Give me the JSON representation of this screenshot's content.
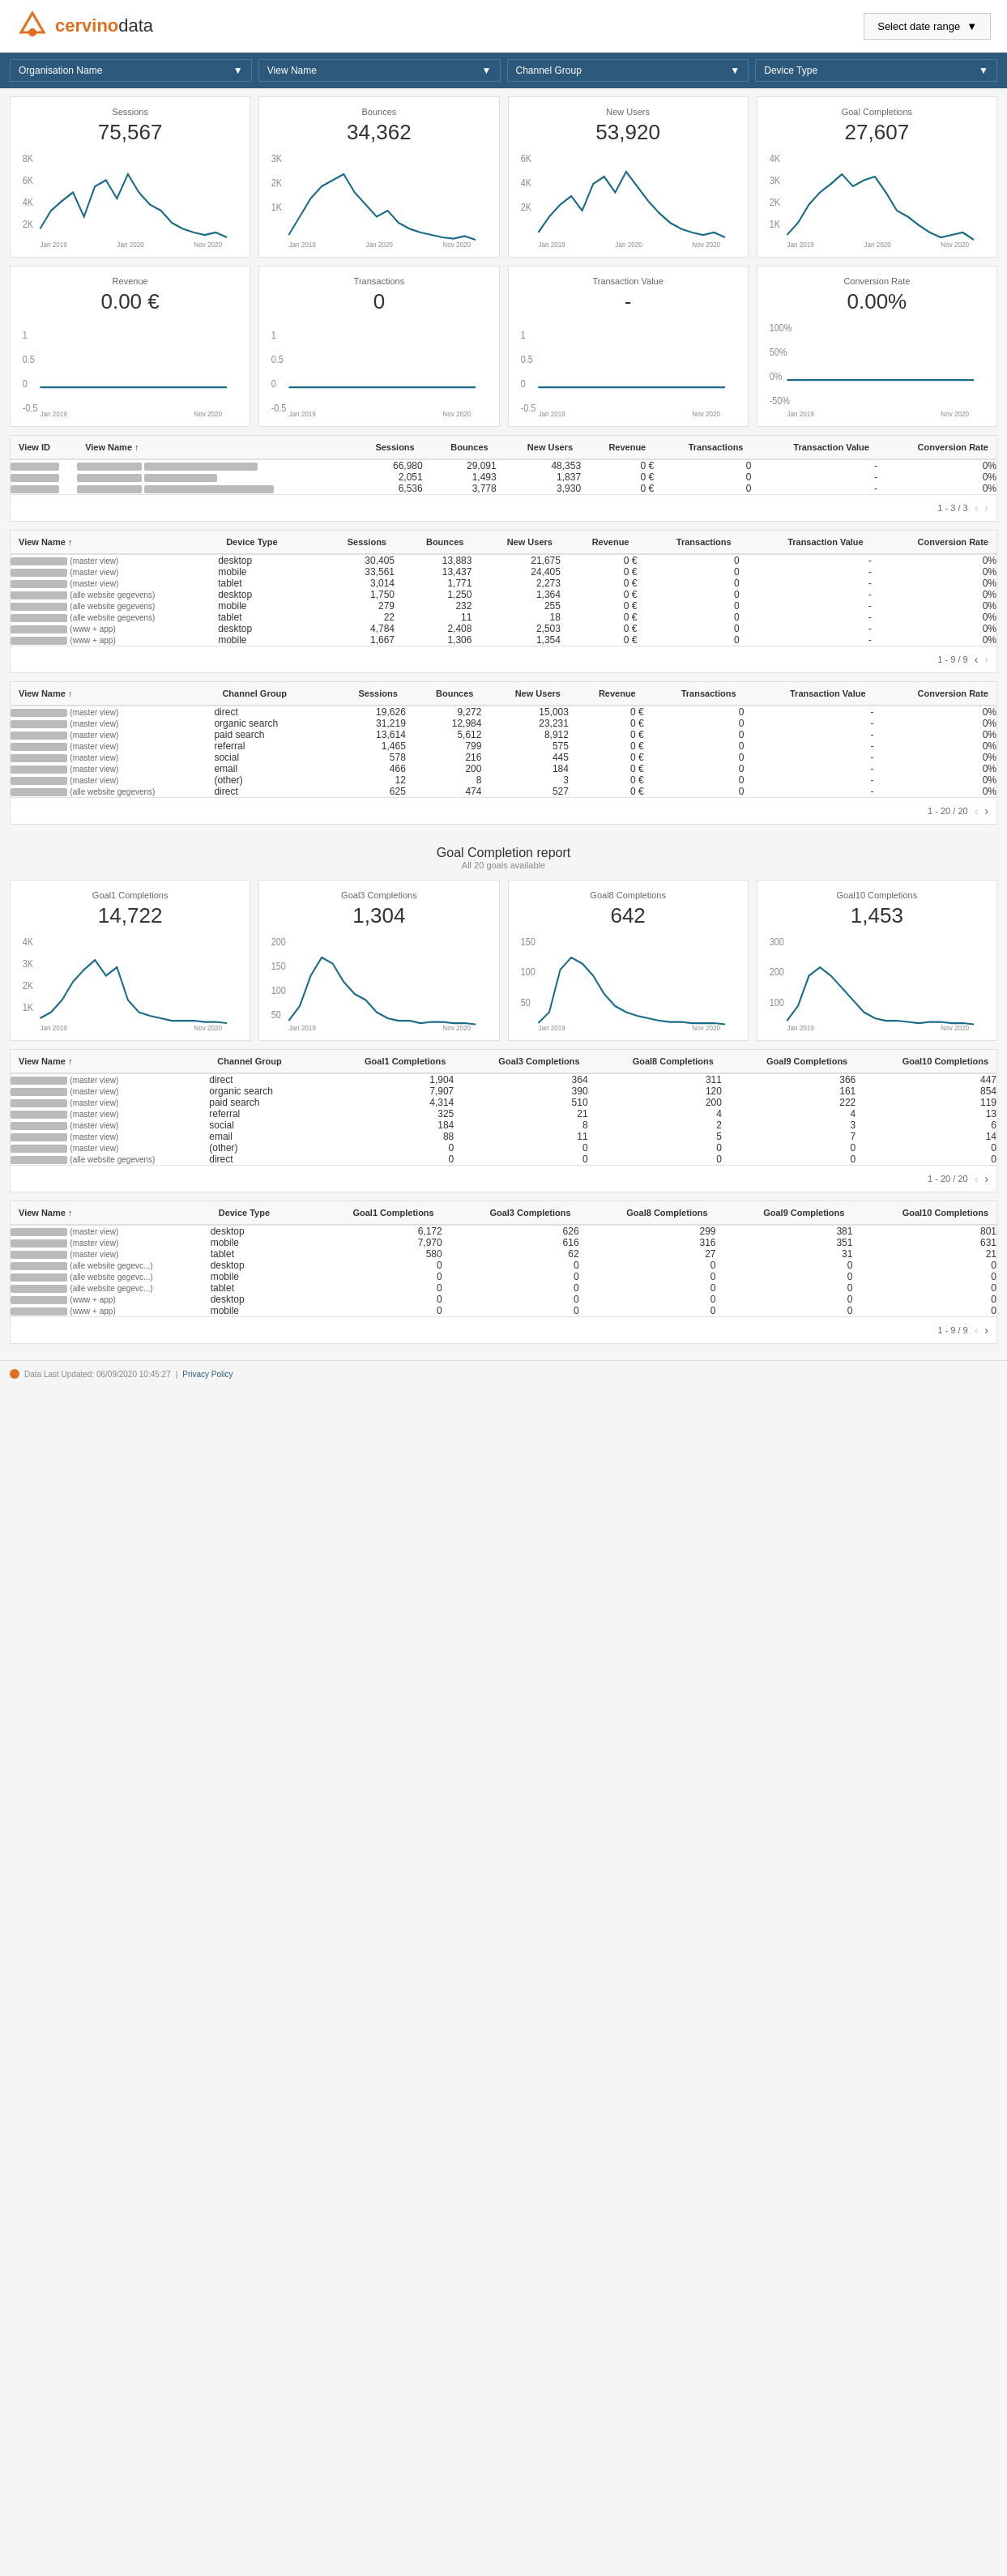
{
  "header": {
    "logo_text": "cervinodata",
    "logo_accent": "cervino",
    "date_range_label": "Select date range"
  },
  "filters": [
    {
      "id": "org",
      "label": "Organisation Name"
    },
    {
      "id": "view",
      "label": "View Name"
    },
    {
      "id": "channel",
      "label": "Channel Group"
    },
    {
      "id": "device",
      "label": "Device Type"
    }
  ],
  "kpi_row1": [
    {
      "id": "sessions",
      "label": "Sessions",
      "value": "75,567"
    },
    {
      "id": "bounces",
      "label": "Bounces",
      "value": "34,362"
    },
    {
      "id": "new_users",
      "label": "New Users",
      "value": "53,920"
    },
    {
      "id": "goal_completions",
      "label": "Goal Completions",
      "value": "27,607"
    }
  ],
  "kpi_row2": [
    {
      "id": "revenue",
      "label": "Revenue",
      "value": "0.00 €"
    },
    {
      "id": "transactions",
      "label": "Transactions",
      "value": "0"
    },
    {
      "id": "transaction_value",
      "label": "Transaction Value",
      "value": "-"
    },
    {
      "id": "conversion_rate",
      "label": "Conversion Rate",
      "value": "0.00%"
    }
  ],
  "table1": {
    "columns": [
      "View ID",
      "View Name ↑",
      "Sessions",
      "Bounces",
      "New Users",
      "Revenue",
      "Transactions",
      "Transaction Value",
      "Conversion Rate"
    ],
    "rows": [
      {
        "view_id": "redacted",
        "view_name": "redacted_lg",
        "sessions": "66,980",
        "bounces": "29,091",
        "new_users": "48,353",
        "revenue": "0 €",
        "transactions": "0",
        "transaction_value": "-",
        "conversion_rate": "0%"
      },
      {
        "view_id": "redacted",
        "view_name": "redacted_md",
        "sessions": "2,051",
        "bounces": "1,493",
        "new_users": "1,837",
        "revenue": "0 €",
        "transactions": "0",
        "transaction_value": "-",
        "conversion_rate": "0%"
      },
      {
        "view_id": "redacted",
        "view_name": "redacted_xl",
        "sessions": "6,536",
        "bounces": "3,778",
        "new_users": "3,930",
        "revenue": "0 €",
        "transactions": "0",
        "transaction_value": "-",
        "conversion_rate": "0%"
      }
    ],
    "pagination": "1 - 3 / 3"
  },
  "table2": {
    "columns": [
      "View Name ↑",
      "Device Type",
      "Sessions",
      "Bounces",
      "New Users",
      "Revenue",
      "Transactions",
      "Transaction Value",
      "Conversion Rate"
    ],
    "rows": [
      {
        "view_name": "redacted",
        "view_sub": "(master view)",
        "device": "desktop",
        "sessions": "30,405",
        "bounces": "13,883",
        "new_users": "21,675",
        "revenue": "0 €",
        "transactions": "0",
        "transaction_value": "-",
        "conversion_rate": "0%"
      },
      {
        "view_name": "redacted",
        "view_sub": "(master view)",
        "device": "mobile",
        "sessions": "33,561",
        "bounces": "13,437",
        "new_users": "24,405",
        "revenue": "0 €",
        "transactions": "0",
        "transaction_value": "-",
        "conversion_rate": "0%"
      },
      {
        "view_name": "redacted",
        "view_sub": "(master view)",
        "device": "tablet",
        "sessions": "3,014",
        "bounces": "1,771",
        "new_users": "2,273",
        "revenue": "0 €",
        "transactions": "0",
        "transaction_value": "-",
        "conversion_rate": "0%"
      },
      {
        "view_name": "redacted",
        "view_sub": "(alle website gegevens)",
        "device": "desktop",
        "sessions": "1,750",
        "bounces": "1,250",
        "new_users": "1,364",
        "revenue": "0 €",
        "transactions": "0",
        "transaction_value": "-",
        "conversion_rate": "0%"
      },
      {
        "view_name": "redacted",
        "view_sub": "(alle website gegevens)",
        "device": "mobile",
        "sessions": "279",
        "bounces": "232",
        "new_users": "255",
        "revenue": "0 €",
        "transactions": "0",
        "transaction_value": "-",
        "conversion_rate": "0%"
      },
      {
        "view_name": "redacted",
        "view_sub": "(alle website gegevens)",
        "device": "tablet",
        "sessions": "22",
        "bounces": "11",
        "new_users": "18",
        "revenue": "0 €",
        "transactions": "0",
        "transaction_value": "-",
        "conversion_rate": "0%"
      },
      {
        "view_name": "redacted",
        "view_sub": "(www + app)",
        "device": "desktop",
        "sessions": "4,784",
        "bounces": "2,408",
        "new_users": "2,503",
        "revenue": "0 €",
        "transactions": "0",
        "transaction_value": "-",
        "conversion_rate": "0%"
      },
      {
        "view_name": "redacted",
        "view_sub": "(www + app)",
        "device": "mobile",
        "sessions": "1,667",
        "bounces": "1,306",
        "new_users": "1,354",
        "revenue": "0 €",
        "transactions": "0",
        "transaction_value": "-",
        "conversion_rate": "0%"
      }
    ],
    "pagination": "1 - 9 / 9"
  },
  "table3": {
    "columns": [
      "View Name ↑",
      "Channel Group",
      "Sessions",
      "Bounces",
      "New Users",
      "Revenue",
      "Transactions",
      "Transaction Value",
      "Conversion Rate"
    ],
    "rows": [
      {
        "view_name": "redacted",
        "view_sub": "(master view)",
        "channel": "direct",
        "sessions": "19,626",
        "bounces": "9,272",
        "new_users": "15,003",
        "revenue": "0 €",
        "transactions": "0",
        "transaction_value": "-",
        "conversion_rate": "0%"
      },
      {
        "view_name": "redacted",
        "view_sub": "(master view)",
        "channel": "organic search",
        "sessions": "31,219",
        "bounces": "12,984",
        "new_users": "23,231",
        "revenue": "0 €",
        "transactions": "0",
        "transaction_value": "-",
        "conversion_rate": "0%"
      },
      {
        "view_name": "redacted",
        "view_sub": "(master view)",
        "channel": "paid search",
        "sessions": "13,614",
        "bounces": "5,612",
        "new_users": "8,912",
        "revenue": "0 €",
        "transactions": "0",
        "transaction_value": "-",
        "conversion_rate": "0%"
      },
      {
        "view_name": "redacted",
        "view_sub": "(master view)",
        "channel": "referral",
        "sessions": "1,465",
        "bounces": "799",
        "new_users": "575",
        "revenue": "0 €",
        "transactions": "0",
        "transaction_value": "-",
        "conversion_rate": "0%"
      },
      {
        "view_name": "redacted",
        "view_sub": "(master view)",
        "channel": "social",
        "sessions": "578",
        "bounces": "216",
        "new_users": "445",
        "revenue": "0 €",
        "transactions": "0",
        "transaction_value": "-",
        "conversion_rate": "0%"
      },
      {
        "view_name": "redacted",
        "view_sub": "(master view)",
        "channel": "email",
        "sessions": "466",
        "bounces": "200",
        "new_users": "184",
        "revenue": "0 €",
        "transactions": "0",
        "transaction_value": "-",
        "conversion_rate": "0%"
      },
      {
        "view_name": "redacted",
        "view_sub": "(master view)",
        "channel": "(other)",
        "sessions": "12",
        "bounces": "8",
        "new_users": "3",
        "revenue": "0 €",
        "transactions": "0",
        "transaction_value": "-",
        "conversion_rate": "0%"
      },
      {
        "view_name": "redacted",
        "view_sub": "(alle website gegevens)",
        "channel": "direct",
        "sessions": "625",
        "bounces": "474",
        "new_users": "527",
        "revenue": "0 €",
        "transactions": "0",
        "transaction_value": "-",
        "conversion_rate": "0%"
      }
    ],
    "pagination": "1 - 20 / 20"
  },
  "goal_section": {
    "title": "Goal Completion report",
    "subtitle": "All 20 goals available"
  },
  "goal_kpis": [
    {
      "id": "goal1",
      "label": "Goal1 Completions",
      "value": "14,722"
    },
    {
      "id": "goal3",
      "label": "Goal3 Completions",
      "value": "1,304"
    },
    {
      "id": "goal8",
      "label": "Goal8 Completions",
      "value": "642"
    },
    {
      "id": "goal10",
      "label": "Goal10 Completions",
      "value": "1,453"
    }
  ],
  "goal_table1": {
    "columns": [
      "View Name ↑",
      "Channel Group",
      "Goal1 Completions",
      "Goal3 Completions",
      "Goal8 Completions",
      "Goal9 Completions",
      "Goal10 Completions"
    ],
    "rows": [
      {
        "view_name": "redacted",
        "view_sub": "(master view)",
        "channel": "direct",
        "g1": "1,904",
        "g3": "364",
        "g8": "311",
        "g9": "366",
        "g10": "447"
      },
      {
        "view_name": "redacted",
        "view_sub": "(master view)",
        "channel": "organic search",
        "g1": "7,907",
        "g3": "390",
        "g8": "120",
        "g9": "161",
        "g10": "854"
      },
      {
        "view_name": "redacted",
        "view_sub": "(master view)",
        "channel": "paid search",
        "g1": "4,314",
        "g3": "510",
        "g8": "200",
        "g9": "222",
        "g10": "119"
      },
      {
        "view_name": "redacted",
        "view_sub": "(master view)",
        "channel": "referral",
        "g1": "325",
        "g3": "21",
        "g8": "4",
        "g9": "4",
        "g10": "13"
      },
      {
        "view_name": "redacted",
        "view_sub": "(master view)",
        "channel": "social",
        "g1": "184",
        "g3": "8",
        "g8": "2",
        "g9": "3",
        "g10": "6"
      },
      {
        "view_name": "redacted",
        "view_sub": "(master view)",
        "channel": "email",
        "g1": "88",
        "g3": "11",
        "g8": "5",
        "g9": "7",
        "g10": "14"
      },
      {
        "view_name": "redacted",
        "view_sub": "(master view)",
        "channel": "(other)",
        "g1": "0",
        "g3": "0",
        "g8": "0",
        "g9": "0",
        "g10": "0"
      },
      {
        "view_name": "redacted",
        "view_sub": "(alle website gegevens)",
        "channel": "direct",
        "g1": "0",
        "g3": "0",
        "g8": "0",
        "g9": "0",
        "g10": "0"
      }
    ],
    "pagination": "1 - 20 / 20"
  },
  "goal_table2": {
    "columns": [
      "View Name ↑",
      "Device Type",
      "Goal1 Completions",
      "Goal3 Completions",
      "Goal8 Completions",
      "Goal9 Completions",
      "Goal10 Completions"
    ],
    "rows": [
      {
        "view_name": "redacted",
        "view_sub": "(master view)",
        "device": "desktop",
        "g1": "6,172",
        "g3": "626",
        "g8": "299",
        "g9": "381",
        "g10": "801"
      },
      {
        "view_name": "redacted",
        "view_sub": "(master view)",
        "device": "mobile",
        "g1": "7,970",
        "g3": "616",
        "g8": "316",
        "g9": "351",
        "g10": "631"
      },
      {
        "view_name": "redacted",
        "view_sub": "(master view)",
        "device": "tablet",
        "g1": "580",
        "g3": "62",
        "g8": "27",
        "g9": "31",
        "g10": "21"
      },
      {
        "view_name": "redacted",
        "view_sub": "(alle website gegevc...)",
        "device": "desktop",
        "g1": "0",
        "g3": "0",
        "g8": "0",
        "g9": "0",
        "g10": "0"
      },
      {
        "view_name": "redacted",
        "view_sub": "(alle website gegevc...)",
        "device": "mobile",
        "g1": "0",
        "g3": "0",
        "g8": "0",
        "g9": "0",
        "g10": "0"
      },
      {
        "view_name": "redacted",
        "view_sub": "(alle website gegevc...)",
        "device": "tablet",
        "g1": "0",
        "g3": "0",
        "g8": "0",
        "g9": "0",
        "g10": "0"
      },
      {
        "view_name": "redacted",
        "view_sub": "(www + app)",
        "device": "desktop",
        "g1": "0",
        "g3": "0",
        "g8": "0",
        "g9": "0",
        "g10": "0"
      },
      {
        "view_name": "redacted",
        "view_sub": "(www + app)",
        "device": "mobile",
        "g1": "0",
        "g3": "0",
        "g8": "0",
        "g9": "0",
        "g10": "0"
      }
    ],
    "pagination": "1 - 9 / 9"
  },
  "footer": {
    "last_updated": "Data Last Updated: 06/09/2020 10:45:27",
    "privacy_link": "Privacy Policy"
  },
  "colors": {
    "header_bg": "#2d5a7c",
    "accent": "#e07020",
    "line_chart": "#1a6b8a",
    "table_header_bg": "#f8f8f8"
  }
}
